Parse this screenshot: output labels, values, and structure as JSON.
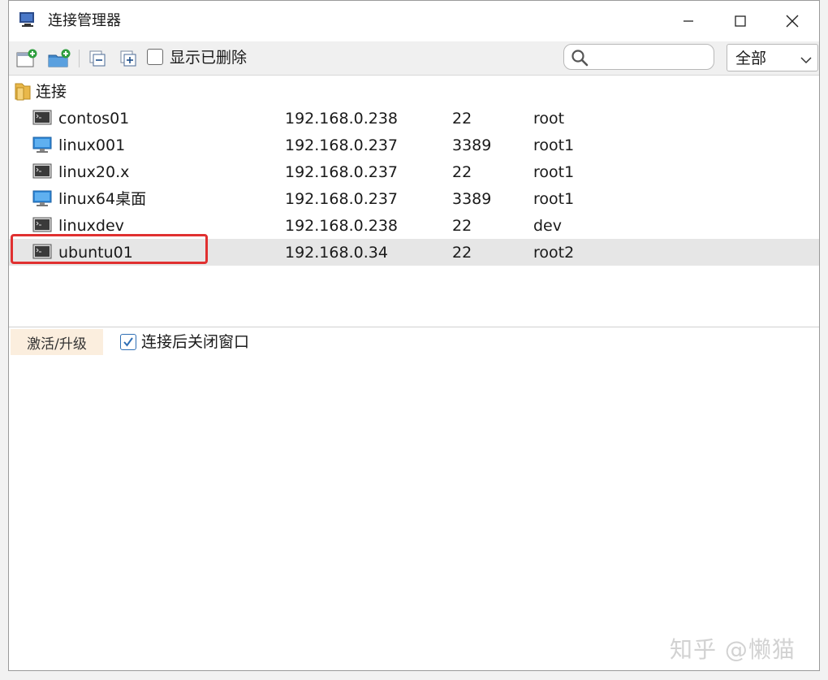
{
  "window": {
    "title": "连接管理器"
  },
  "toolbar": {
    "show_deleted_label": "显示已删除",
    "show_deleted_checked": false,
    "search_placeholder": "",
    "filter_value": "全部"
  },
  "tree": {
    "group_label": "连接",
    "rows": [
      {
        "name": "contos01",
        "host": "192.168.0.238",
        "port": "22",
        "user": "root",
        "icon": "terminal-icon"
      },
      {
        "name": "linux001",
        "host": "192.168.0.237",
        "port": "3389",
        "user": "root1",
        "icon": "desktop-icon"
      },
      {
        "name": "linux20.x",
        "host": "192.168.0.237",
        "port": "22",
        "user": "root1",
        "icon": "terminal-icon"
      },
      {
        "name": "linux64桌面",
        "host": "192.168.0.237",
        "port": "3389",
        "user": "root1",
        "icon": "desktop-icon"
      },
      {
        "name": "linuxdev",
        "host": "192.168.0.238",
        "port": "22",
        "user": "dev",
        "icon": "terminal-icon"
      },
      {
        "name": "ubuntu01",
        "host": "192.168.0.34",
        "port": "22",
        "user": "root2",
        "icon": "terminal-icon",
        "selected": true
      }
    ]
  },
  "bottom": {
    "activate_label": "激活/升级",
    "close_after_connect_label": "连接后关闭窗口",
    "close_after_connect_checked": true
  },
  "watermark": "知乎 @懒猫",
  "colors": {
    "highlight": "#e03030",
    "selected_row": "#e6e6e6",
    "activate_bg": "#fbeede",
    "checkbox_accent": "#2f6fb5"
  }
}
